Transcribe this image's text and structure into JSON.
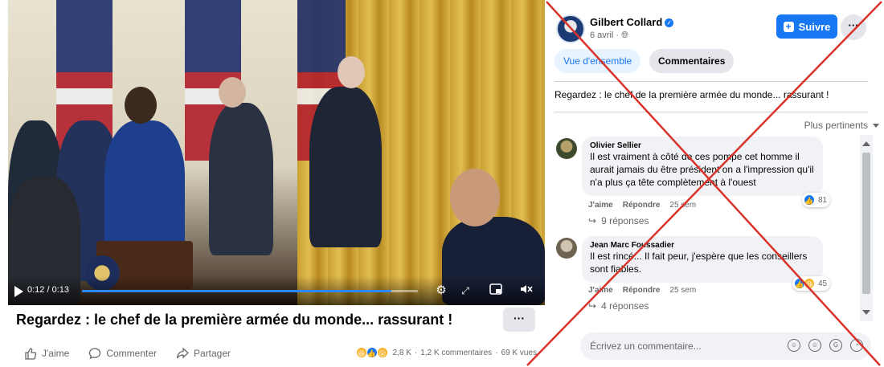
{
  "video": {
    "time": "0:12 / 0:13",
    "progress": 0.92
  },
  "post": {
    "title": "Regardez : le chef de la première armée du monde... rassurant !",
    "more_label": "···",
    "actions": {
      "like": "J'aime",
      "comment": "Commenter",
      "share": "Partager"
    },
    "stats": {
      "reactions": "2,8 K",
      "comments": "1,2 K commentaires",
      "views": "69 K vues"
    }
  },
  "panel": {
    "author": "Gilbert Collard",
    "date": "6 avril ·",
    "follow_label": "Suivre",
    "more_label": "···",
    "tabs": [
      "Vue d'ensemble",
      "Commentaires"
    ],
    "caption": "Regardez : le chef de la première armée du monde... rassurant !",
    "sort_label": "Plus pertinents",
    "comments": [
      {
        "author": "Olivier Sellier",
        "text": "Il est vraiment à côté de ces pompe cet homme il aurait jamais du être président on a l'impression qu'il n'a plus ça tête complètement à l'ouest",
        "like": "J'aime",
        "reply": "Répondre",
        "time": "25 sem",
        "reactions": "81",
        "replies": "9 réponses"
      },
      {
        "author": "Jean Marc Foussadier",
        "text": "Il est rincé... Il fait peur, j'espère que les conseillers sont fiables.",
        "like": "J'aime",
        "reply": "Répondre",
        "time": "25 sem",
        "reactions": "45",
        "replies": "4 réponses"
      }
    ],
    "composer_placeholder": "Écrivez un commentaire..."
  },
  "colors": {
    "accent": "#1877f2",
    "cross": "#d9342b"
  }
}
